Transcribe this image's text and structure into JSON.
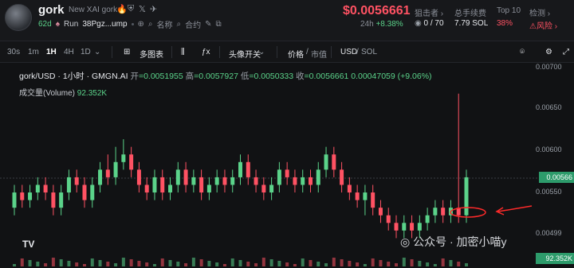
{
  "token": {
    "symbol": "gork",
    "description": "New XAI gork",
    "age": "62d",
    "run_label": "Run",
    "address_short": "38Pgz...ump",
    "search_label": "名称",
    "contract_label": "合约"
  },
  "market": {
    "price": "$0.0056661",
    "period_label": "24h",
    "change": "+8.38%",
    "stats": [
      {
        "label": "狙击者 ›",
        "value": "0 / 70"
      },
      {
        "label": "总手续费",
        "value": "7.79 SOL"
      },
      {
        "label": "Top 10",
        "value": "38%"
      },
      {
        "label": "检测 ›",
        "value": "风险 ›"
      }
    ]
  },
  "toolbar": {
    "intervals": [
      "30s",
      "1m",
      "1H",
      "4H",
      "1D"
    ],
    "active_interval": "1H",
    "indicators_label": "多图表",
    "avatar_toggle_label": "头像开关",
    "price_label": "价格",
    "mcap_label": "市值",
    "usd_label": "USD",
    "sol_label": "SOL"
  },
  "chart_legend": {
    "title": "gork/USD · 1小时 · GMGN.AI",
    "open_label": "开",
    "open": "=0.0051955",
    "high_label": "高",
    "high": "=0.0057927",
    "low_label": "低",
    "low": "=0.0050333",
    "close_label": "收",
    "close": "=0.0056661",
    "change": "0.00047059 (+9.06%)",
    "volume_label": "成交量(Volume)",
    "volume": "92.352K"
  },
  "y_axis": [
    "0.00700",
    "0.00650",
    "0.00600",
    "0.00550",
    "0.00499"
  ],
  "current_price_tag": "0.00566",
  "volume_tag": "92.352K",
  "watermark": "公众号 · 加密小喵y",
  "colors": {
    "up": "#5bd38a",
    "down": "#ff5263",
    "annotation": "#ff2a2a"
  },
  "chart_data": {
    "type": "candlestick",
    "ylim": [
      0.0048,
      0.0071
    ],
    "values": [
      [
        0.0053,
        0.0055,
        0.0056,
        0.0052
      ],
      [
        0.0055,
        0.0054,
        0.0056,
        0.0053
      ],
      [
        0.0054,
        0.0055,
        0.0056,
        0.0053
      ],
      [
        0.0055,
        0.0056,
        0.0057,
        0.0054
      ],
      [
        0.0056,
        0.0055,
        0.0057,
        0.0054
      ],
      [
        0.0055,
        0.0053,
        0.0056,
        0.0052
      ],
      [
        0.0053,
        0.0055,
        0.0056,
        0.0052
      ],
      [
        0.0055,
        0.0057,
        0.0058,
        0.0054
      ],
      [
        0.0057,
        0.0056,
        0.0058,
        0.0055
      ],
      [
        0.0056,
        0.0054,
        0.0057,
        0.0053
      ],
      [
        0.0054,
        0.0056,
        0.0057,
        0.0053
      ],
      [
        0.0056,
        0.0058,
        0.0059,
        0.0055
      ],
      [
        0.0058,
        0.0057,
        0.006,
        0.0056
      ],
      [
        0.0057,
        0.0059,
        0.0061,
        0.0056
      ],
      [
        0.0059,
        0.006,
        0.0062,
        0.0058
      ],
      [
        0.006,
        0.0058,
        0.0061,
        0.0057
      ],
      [
        0.0058,
        0.0056,
        0.0059,
        0.0055
      ],
      [
        0.0056,
        0.0055,
        0.0057,
        0.0054
      ],
      [
        0.0055,
        0.0057,
        0.0058,
        0.0054
      ],
      [
        0.0057,
        0.0055,
        0.0058,
        0.0054
      ],
      [
        0.0055,
        0.0056,
        0.0057,
        0.0054
      ],
      [
        0.0056,
        0.0058,
        0.0059,
        0.0055
      ],
      [
        0.0058,
        0.0056,
        0.0059,
        0.0055
      ],
      [
        0.0056,
        0.0057,
        0.0058,
        0.0055
      ],
      [
        0.0057,
        0.0055,
        0.0058,
        0.0054
      ],
      [
        0.0055,
        0.0056,
        0.0057,
        0.0054
      ],
      [
        0.0056,
        0.0057,
        0.0058,
        0.0055
      ],
      [
        0.0057,
        0.0056,
        0.0058,
        0.0055
      ],
      [
        0.0056,
        0.0057,
        0.0058,
        0.0055
      ],
      [
        0.0057,
        0.0059,
        0.006,
        0.0056
      ],
      [
        0.0059,
        0.0057,
        0.006,
        0.0056
      ],
      [
        0.0057,
        0.0056,
        0.0058,
        0.0055
      ],
      [
        0.0056,
        0.0055,
        0.0057,
        0.0054
      ],
      [
        0.0055,
        0.0056,
        0.0057,
        0.0054
      ],
      [
        0.0056,
        0.0058,
        0.0059,
        0.0055
      ],
      [
        0.0058,
        0.0057,
        0.0059,
        0.0056
      ],
      [
        0.0057,
        0.0056,
        0.0058,
        0.0055
      ],
      [
        0.0056,
        0.0057,
        0.0058,
        0.0055
      ],
      [
        0.0057,
        0.0056,
        0.0058,
        0.0055
      ],
      [
        0.0056,
        0.0058,
        0.0059,
        0.0055
      ],
      [
        0.0058,
        0.006,
        0.0061,
        0.0057
      ],
      [
        0.006,
        0.0058,
        0.0061,
        0.0057
      ],
      [
        0.0058,
        0.0056,
        0.0059,
        0.0055
      ],
      [
        0.0056,
        0.0055,
        0.0057,
        0.0054
      ],
      [
        0.0055,
        0.0054,
        0.0056,
        0.0053
      ],
      [
        0.0054,
        0.0055,
        0.0056,
        0.0052
      ],
      [
        0.0055,
        0.0053,
        0.0056,
        0.0052
      ],
      [
        0.0053,
        0.0052,
        0.0054,
        0.0051
      ],
      [
        0.0052,
        0.0051,
        0.0053,
        0.005
      ],
      [
        0.0051,
        0.005,
        0.0052,
        0.0049
      ],
      [
        0.005,
        0.0051,
        0.0052,
        0.0049
      ],
      [
        0.0051,
        0.005,
        0.0052,
        0.0049
      ],
      [
        0.005,
        0.0051,
        0.0052,
        0.0049
      ],
      [
        0.0051,
        0.0052,
        0.0053,
        0.005
      ],
      [
        0.0052,
        0.0053,
        0.0054,
        0.0051
      ],
      [
        0.0053,
        0.0052,
        0.0054,
        0.0051
      ],
      [
        0.0052,
        0.0053,
        0.0054,
        0.0051
      ],
      [
        0.0053,
        0.0052,
        0.0068,
        0.0051
      ],
      [
        0.0052,
        0.0057,
        0.0058,
        0.0051
      ]
    ]
  }
}
